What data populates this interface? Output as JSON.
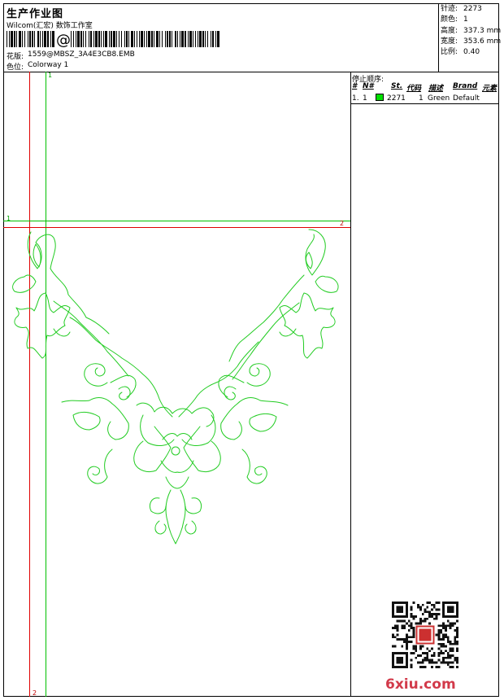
{
  "header": {
    "title": "生产作业图",
    "company": "Wilcom(汇宏) 数饰工作室",
    "pattern_label": "花版:",
    "pattern_value": "1559@MBSZ_3A4E3CB8.EMB",
    "colorway_label": "色位:",
    "colorway_value": "Colorway 1"
  },
  "stats": {
    "stitches_label": "针迹:",
    "stitches_value": "2273",
    "colors_label": "颜色:",
    "colors_value": "1",
    "height_label": "高度:",
    "height_value": "337.3 mm",
    "width_label": "宽度:",
    "width_value": "353.6 mm",
    "scale_label": "比例:",
    "scale_value": "0.40"
  },
  "stop_sequence": {
    "title": "停止顺序:",
    "columns": [
      "#",
      "N#",
      "St.",
      "代码",
      "描述",
      "Brand",
      "元素"
    ],
    "rows": [
      {
        "index": "1.",
        "needle": "1",
        "stitches": "2271",
        "code": "1",
        "description": "Green",
        "brand": "Default",
        "color": "#00e000"
      }
    ]
  },
  "guides": {
    "v1_label": "1",
    "h1_label": "1",
    "h2_label": "2",
    "v2_label": "2"
  },
  "watermark": {
    "site": "6xiu.com"
  },
  "colors": {
    "design": "#22cc22",
    "guide_red": "#e00000",
    "guide_green": "#00c000",
    "site_text": "#d23a4a"
  }
}
